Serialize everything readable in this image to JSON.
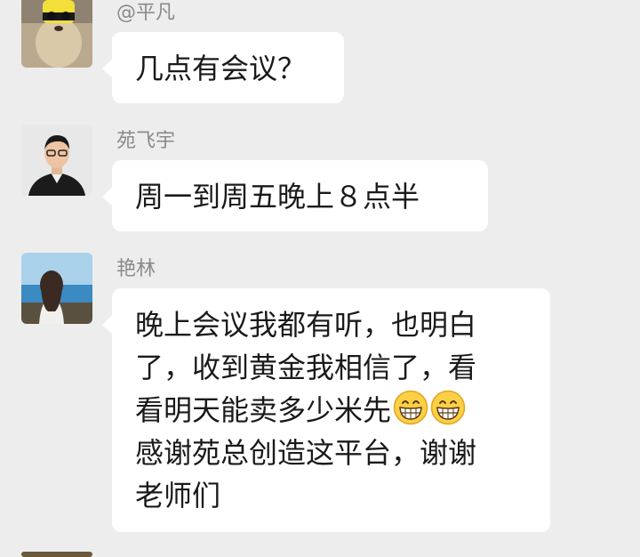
{
  "messages": [
    {
      "sender": "@平凡",
      "lines": [
        "几点有会议？"
      ]
    },
    {
      "sender": "苑飞宇",
      "lines": [
        "周一到周五晚上８点半"
      ]
    },
    {
      "sender": "艳林",
      "lines": [
        "晚上会议我都有听，也明白",
        "了，收到黄金我相信了，看",
        "看明天能卖多少米先",
        "感谢苑总创造这平台，谢谢",
        "老师们"
      ],
      "emoji": [
        "grinning-face-emoji",
        "grinning-face-emoji"
      ]
    }
  ],
  "colors": {
    "background": "#ededed",
    "bubble": "#ffffff",
    "sender_name": "#8a8a8a",
    "text": "#1a1a1a"
  }
}
